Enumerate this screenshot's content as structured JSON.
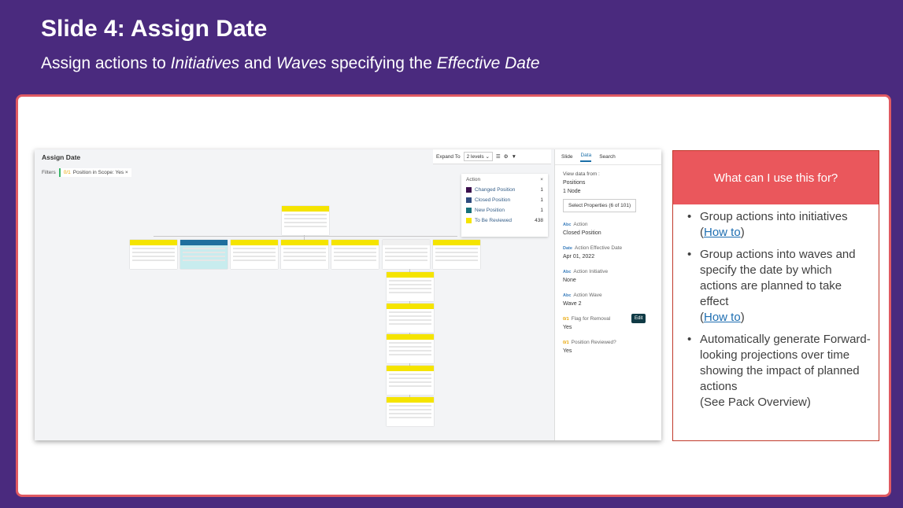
{
  "slide": {
    "title": "Slide 4: Assign Date",
    "subtitle_parts": [
      "Assign actions to ",
      "Initiatives",
      " and ",
      "Waves",
      " specifying the ",
      "Effective Date"
    ]
  },
  "app": {
    "title": "Assign Date",
    "filters_label": "Filters",
    "filter_chip": "Position in Scope: Yes",
    "filter_chip_icon": "0/1",
    "toolbar": {
      "expand_label": "Expand To",
      "levels_value": "2 levels"
    },
    "legend": {
      "title": "Action",
      "items": [
        {
          "label": "Changed Position",
          "count": "1",
          "color": "#3b0f4d"
        },
        {
          "label": "Closed Position",
          "count": "1",
          "color": "#2e4b7e"
        },
        {
          "label": "New Position",
          "count": "1",
          "color": "#16707a"
        },
        {
          "label": "To Be Reviewed",
          "count": "438",
          "color": "#f5e400"
        }
      ]
    },
    "side": {
      "tabs": [
        "Slide",
        "Data",
        "Search"
      ],
      "view_from": "View data from :",
      "positions": "Positions",
      "node": "1 Node",
      "select_props": "Select Properties",
      "select_props_count": "(6 of 101)",
      "fields": [
        {
          "tag": "Abc",
          "key": "Action",
          "value": "Closed Position"
        },
        {
          "tag": "Date",
          "key": "Action Effective Date",
          "value": "Apr 01, 2022"
        },
        {
          "tag": "Abc",
          "key": "Action Initiative",
          "value": "None"
        },
        {
          "tag": "Abc",
          "key": "Action Wave",
          "value": "Wave 2"
        },
        {
          "tag": "0/1",
          "key": "Flag for Removal",
          "value": "Yes"
        },
        {
          "tag": "0/1",
          "key": "Position Reviewed?",
          "value": "Yes"
        }
      ],
      "edit_tip": "Edit"
    }
  },
  "info": {
    "heading": "What can I use this for?",
    "bullets": [
      {
        "text": "Group actions into initiatives",
        "link": "How to"
      },
      {
        "text": "Group actions into waves and specify the date by which actions are planned to take effect",
        "link": "How to"
      },
      {
        "text": "Automatically generate Forward-looking projections over time showing the impact of planned actions",
        "note": "(See Pack Overview)"
      }
    ]
  }
}
